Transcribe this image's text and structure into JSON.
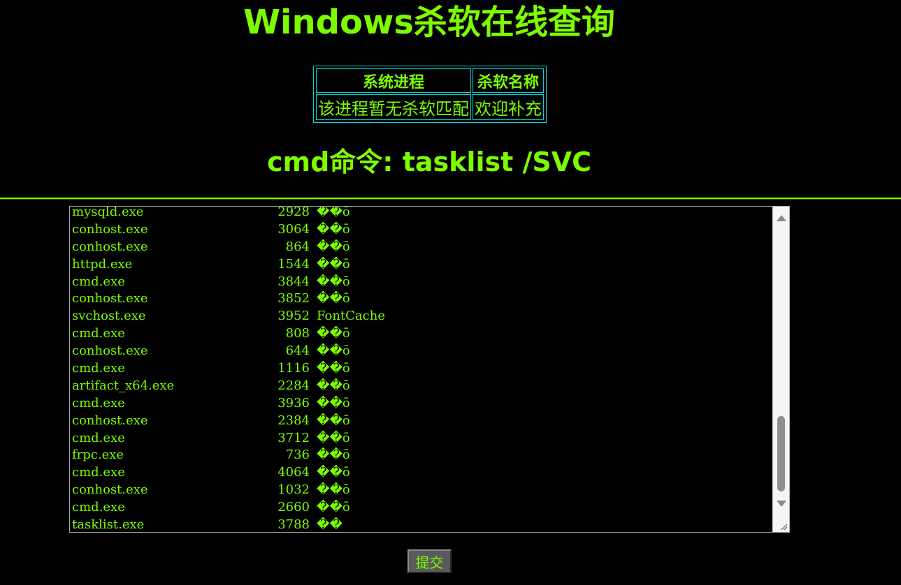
{
  "page": {
    "title": "Windows杀软在线查询",
    "cmd_heading": "cmd命令: tasklist /SVC",
    "submit_label": "提交"
  },
  "result_table": {
    "headers": [
      "系统进程",
      "杀软名称"
    ],
    "rows": [
      [
        "该进程暂无杀软匹配",
        "欢迎补充"
      ]
    ]
  },
  "tasklist_output": [
    {
      "name": "mysqld.exe",
      "pid": "2928",
      "service": "��ṑ"
    },
    {
      "name": "conhost.exe",
      "pid": "3064",
      "service": "��ō"
    },
    {
      "name": "conhost.exe",
      "pid": "864",
      "service": "��ō"
    },
    {
      "name": "httpd.exe",
      "pid": "1544",
      "service": "��ō"
    },
    {
      "name": "cmd.exe",
      "pid": "3844",
      "service": "��ō"
    },
    {
      "name": "conhost.exe",
      "pid": "3852",
      "service": "��ō"
    },
    {
      "name": "svchost.exe",
      "pid": "3952",
      "service": "FontCache"
    },
    {
      "name": "cmd.exe",
      "pid": "808",
      "service": "��ō"
    },
    {
      "name": "conhost.exe",
      "pid": "644",
      "service": "��ō"
    },
    {
      "name": "cmd.exe",
      "pid": "1116",
      "service": "��ō"
    },
    {
      "name": "artifact_x64.exe",
      "pid": "2284",
      "service": "��ō"
    },
    {
      "name": "cmd.exe",
      "pid": "3936",
      "service": "��ō"
    },
    {
      "name": "conhost.exe",
      "pid": "2384",
      "service": "��ō"
    },
    {
      "name": "cmd.exe",
      "pid": "3712",
      "service": "��ō"
    },
    {
      "name": "frpc.exe",
      "pid": "736",
      "service": "��ō"
    },
    {
      "name": "cmd.exe",
      "pid": "4064",
      "service": "��ō"
    },
    {
      "name": "conhost.exe",
      "pid": "1032",
      "service": "��ō"
    },
    {
      "name": "cmd.exe",
      "pid": "2660",
      "service": "��ō"
    },
    {
      "name": "tasklist.exe",
      "pid": "3788",
      "service": "��"
    }
  ],
  "colors": {
    "text": "#7cfc00",
    "background": "#000000",
    "table_border": "#00d7d7"
  },
  "icons": {
    "scroll_up": "triangle-up-icon",
    "scroll_down": "triangle-down-icon",
    "resize": "resize-grip-icon"
  }
}
